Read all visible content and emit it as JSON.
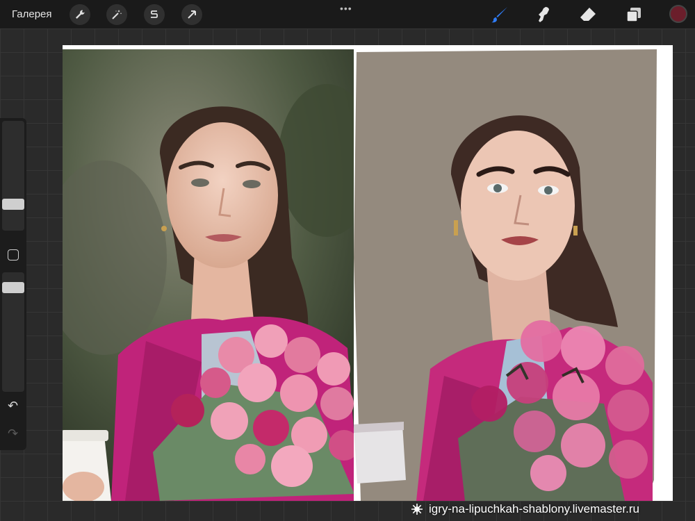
{
  "topbar": {
    "gallery_label": "Галерея",
    "left_tools": [
      "wrench-icon",
      "magic-wand-icon",
      "selection-icon",
      "transform-arrow-icon"
    ],
    "more_label": "•••",
    "right_tools": [
      "brush-icon",
      "smudge-icon",
      "eraser-icon",
      "layers-icon"
    ],
    "active_tool": "brush-icon",
    "current_color": "#6b1e2b",
    "accent_color": "#2f7cf6"
  },
  "sidebar": {
    "brush_size_slider": "slider",
    "opacity_slider": "slider",
    "undo_label": "↶",
    "redo_label": "↷"
  },
  "canvas": {
    "left_image": "reference photo of woman with pink roses",
    "right_image": "digital painting of woman with pink roses"
  },
  "watermark": {
    "text": "igry-na-lipuchkah-shablony.livemaster.ru"
  }
}
